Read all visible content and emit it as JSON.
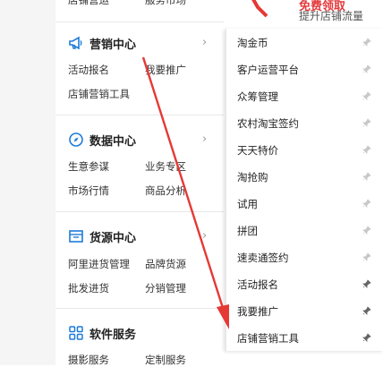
{
  "top_cut": [
    "店铺营运",
    "服务市场"
  ],
  "promo": {
    "title": "免费领取",
    "subtitle": "提升店铺流量"
  },
  "sections": [
    {
      "title": "营销中心",
      "icon": "megaphone-icon",
      "links": [
        "活动报名",
        "我要推广",
        "店铺营销工具"
      ]
    },
    {
      "title": "数据中心",
      "icon": "compass-icon",
      "links": [
        "生意参谋",
        "业务专区",
        "市场行情",
        "商品分析"
      ]
    },
    {
      "title": "货源中心",
      "icon": "storefront-icon",
      "links": [
        "阿里进货管理",
        "品牌货源",
        "批发进货",
        "分销管理"
      ]
    },
    {
      "title": "软件服务",
      "icon": "apps-grid-icon",
      "links": [
        "摄影服务",
        "定制服务"
      ]
    }
  ],
  "flyout": {
    "items": [
      {
        "label": "淘金币",
        "pinned": false
      },
      {
        "label": "客户运营平台",
        "pinned": false
      },
      {
        "label": "众筹管理",
        "pinned": false
      },
      {
        "label": "农村淘宝签约",
        "pinned": false
      },
      {
        "label": "天天特价",
        "pinned": false
      },
      {
        "label": "淘抢购",
        "pinned": false
      },
      {
        "label": "试用",
        "pinned": false
      },
      {
        "label": "拼团",
        "pinned": false
      },
      {
        "label": "速卖通签约",
        "pinned": false
      },
      {
        "label": "活动报名",
        "pinned": true
      },
      {
        "label": "我要推广",
        "pinned": true
      },
      {
        "label": "店铺营销工具",
        "pinned": true
      }
    ]
  },
  "colors": {
    "accent_blue": "#1d7bd8",
    "annotation_red": "#e53935",
    "pin_inactive": "#c8c8c8",
    "pin_active": "#666666"
  }
}
